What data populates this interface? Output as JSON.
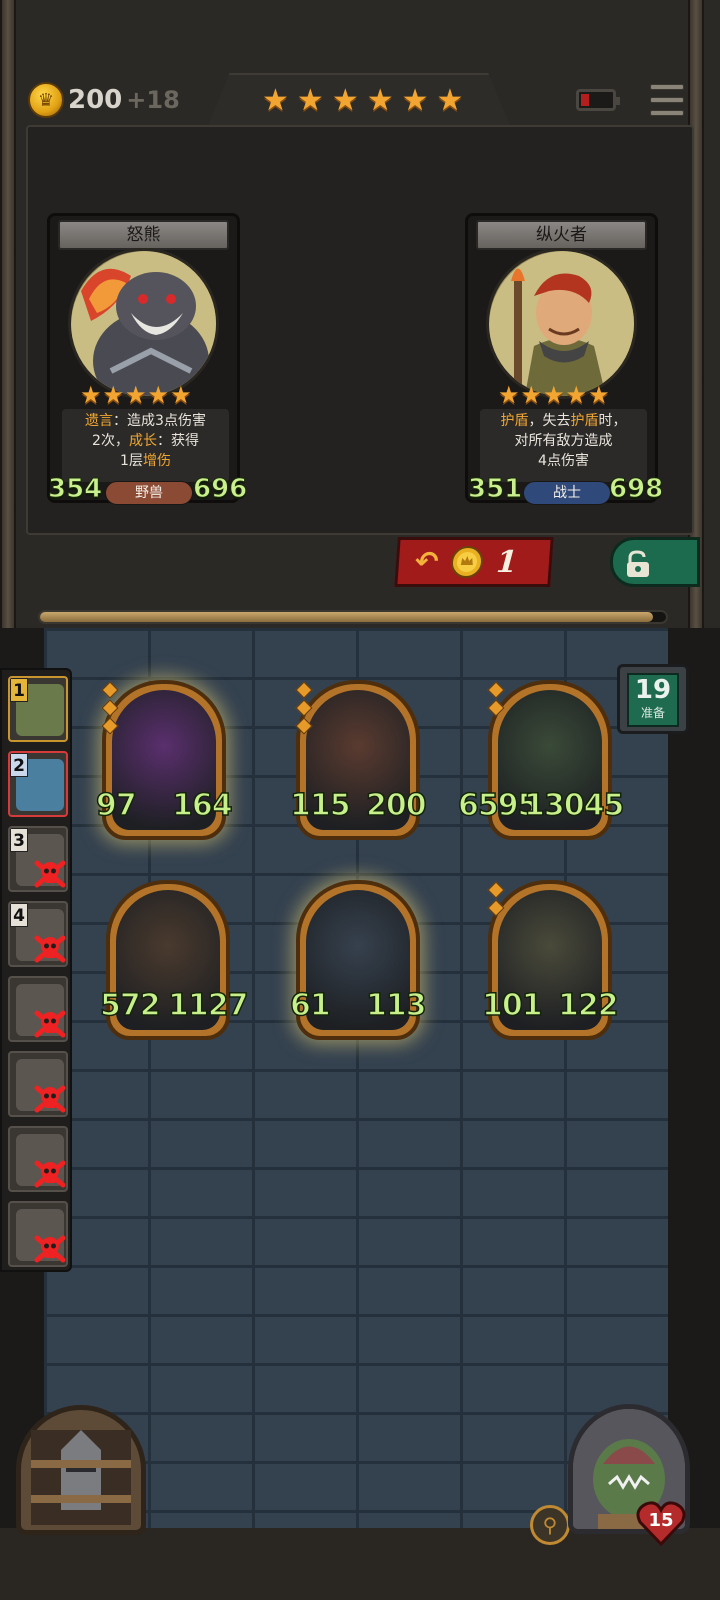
{
  "header": {
    "gold": "200",
    "gold_income": "+18",
    "tavern_tier_stars": 6,
    "battery_level": 0.25
  },
  "shop": {
    "cards": [
      {
        "name": "怒熊",
        "stars": 5,
        "desc_parts": [
          {
            "t": "遗言",
            "hl": true
          },
          {
            "t": "：造成3点伤害",
            "hl": false
          },
          {
            "t": "\n2次，",
            "hl": false
          },
          {
            "t": "成长",
            "hl": true
          },
          {
            "t": "：获得\n1层",
            "hl": false
          },
          {
            "t": "增伤",
            "hl": true
          }
        ],
        "attack": "354",
        "health": "696",
        "tribe": "野兽",
        "tribe_color": "#8a4a34"
      },
      {
        "name": "纵火者",
        "stars": 5,
        "desc_parts": [
          {
            "t": "护盾",
            "hl": true
          },
          {
            "t": "，失去",
            "hl": false
          },
          {
            "t": "护盾",
            "hl": true
          },
          {
            "t": "时，\n对所有敌方造成\n4点伤害",
            "hl": false
          }
        ],
        "attack": "351",
        "health": "698",
        "tribe": "战士",
        "tribe_color": "#2f4a7a"
      }
    ],
    "refresh_cost": "1",
    "lock_icon": "unlocked-padlock-icon",
    "timer_progress": 0.98
  },
  "board": {
    "ready_count": "19",
    "ready_label": "准备",
    "minions": [
      {
        "name": "boar",
        "attack": "97",
        "health": "164",
        "art_color": "#5a2f6e",
        "glow": true,
        "gems": 3
      },
      {
        "name": "vampire-lady",
        "attack": "115",
        "health": "200",
        "art_color": "#5a3b30",
        "glow": false,
        "gems": 3
      },
      {
        "name": "goblin-beast",
        "attack": "6595",
        "health": "13045",
        "art_color": "#3a4a38",
        "glow": false,
        "gems": 2
      },
      {
        "name": "masked-rat",
        "attack": "572",
        "health": "1127",
        "art_color": "#4a3a2e",
        "glow": false,
        "gems": 0
      },
      {
        "name": "elf-sorceress",
        "attack": "61",
        "health": "113",
        "art_color": "#36414e",
        "glow": true,
        "gems": 0
      },
      {
        "name": "fairy",
        "attack": "101",
        "health": "122",
        "art_color": "#4a4a3a",
        "glow": false,
        "gems": 2
      }
    ]
  },
  "players": [
    {
      "rank": "1",
      "state": "me",
      "eliminated": false
    },
    {
      "rank": "2",
      "state": "active",
      "eliminated": false
    },
    {
      "rank": "3",
      "state": "normal",
      "eliminated": true
    },
    {
      "rank": "4",
      "state": "normal",
      "eliminated": true
    },
    {
      "rank": "",
      "state": "normal",
      "eliminated": true
    },
    {
      "rank": "",
      "state": "normal",
      "eliminated": true
    },
    {
      "rank": "",
      "state": "normal",
      "eliminated": true
    },
    {
      "rank": "",
      "state": "normal",
      "eliminated": true
    }
  ],
  "hero": {
    "health": "15"
  }
}
